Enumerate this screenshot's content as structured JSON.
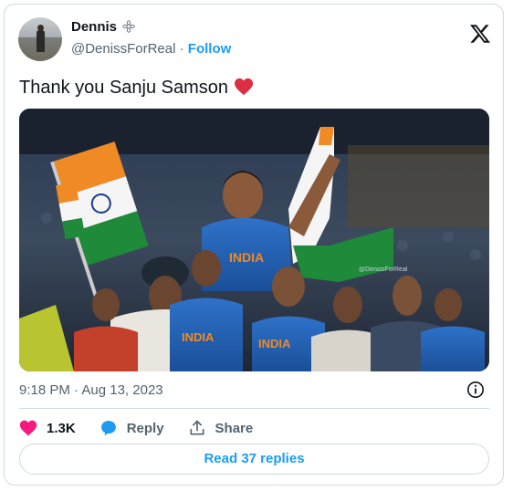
{
  "author": {
    "display_name": "Dennis",
    "badge_icon": "flower-badge-icon",
    "handle": "@DenissForReal",
    "separator": "·",
    "follow_label": "Follow"
  },
  "brand_icon": "x-logo-icon",
  "tweet": {
    "text": "Thank you Sanju Samson",
    "emoji_icon": "red-heart-icon"
  },
  "media": {
    "watermark": "@DenissForReal",
    "jersey_text": "INDIA",
    "description_icon": "cricket-celebration-photo"
  },
  "meta": {
    "time": "9:18 PM",
    "separator": "·",
    "date": "Aug 13, 2023"
  },
  "actions": {
    "like_count": "1.3K",
    "reply_label": "Reply",
    "share_label": "Share"
  },
  "read_replies_label": "Read 37 replies",
  "colors": {
    "accent": "#1d9bf0",
    "like": "#f91880",
    "text": "#0f1419",
    "muted": "#536471",
    "border": "#cfd9de"
  }
}
